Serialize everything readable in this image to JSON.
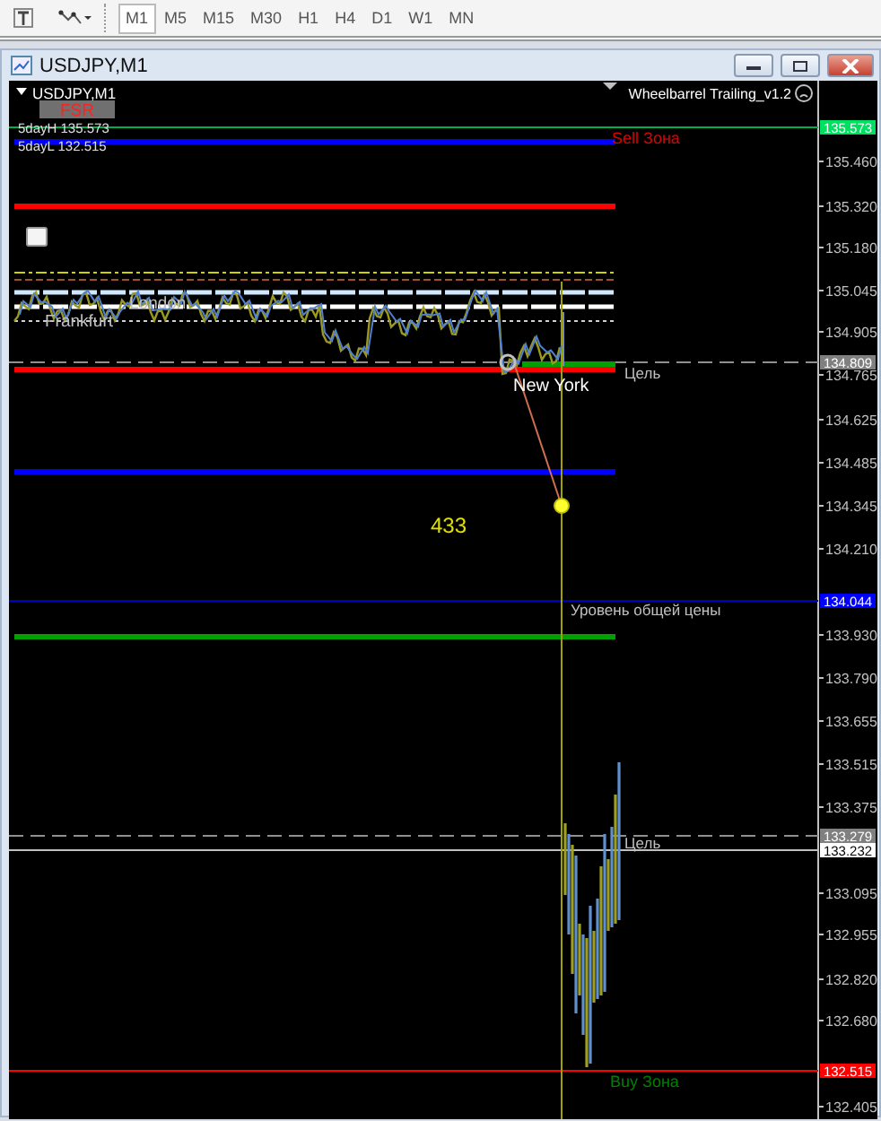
{
  "toolbar": {
    "timeframes": [
      {
        "label": "M1",
        "selected": true
      },
      {
        "label": "M5",
        "selected": false
      },
      {
        "label": "M15",
        "selected": false
      },
      {
        "label": "M30",
        "selected": false
      },
      {
        "label": "H1",
        "selected": false
      },
      {
        "label": "H4",
        "selected": false
      },
      {
        "label": "D1",
        "selected": false
      },
      {
        "label": "W1",
        "selected": false
      },
      {
        "label": "MN",
        "selected": false
      }
    ]
  },
  "window": {
    "title": "USDJPY,M1"
  },
  "chart": {
    "symbol": "USDJPY,M1",
    "indicator": "Wheelbarrel Trailing_v1.2",
    "badge": "FSR",
    "day_high": "5dayH 135.573",
    "day_low": "5dayL 132.515",
    "checkbox": {
      "checked": false
    },
    "labels": [
      {
        "text": "Sell Зона",
        "color": "#e00000"
      },
      {
        "text": "Цель",
        "color": "#c0c0c0"
      },
      {
        "text": "Уровень общей цены",
        "color": "#c0c0c0"
      },
      {
        "text": "Цель",
        "color": "#c0c0c0"
      },
      {
        "text": "Buy Зона",
        "color": "#008000"
      },
      {
        "text": "Frankfurt",
        "color": "#c0c0c0"
      },
      {
        "text": "London",
        "color": "#c0c0c0"
      },
      {
        "text": "New York",
        "color": "#ffffff"
      },
      {
        "text": "433",
        "color": "#e0e000"
      }
    ],
    "axis_ticks": [
      "135.460",
      "135.320",
      "135.180",
      "135.045",
      "134.905",
      "134.765",
      "134.625",
      "134.485",
      "134.345",
      "134.210",
      "133.930",
      "133.790",
      "133.655",
      "133.515",
      "133.375",
      "133.095",
      "132.955",
      "132.820",
      "132.680",
      "132.405"
    ],
    "price_tags": [
      {
        "text": "135.573",
        "color": "#00e060"
      },
      {
        "text": "134.809",
        "color": "#808080"
      },
      {
        "text": "134.044",
        "color": "#0000ff"
      },
      {
        "text": "133.279",
        "color": "#808080"
      },
      {
        "text": "133.232",
        "color": "#ffffff"
      },
      {
        "text": "132.515",
        "color": "#ff0000"
      }
    ]
  }
}
